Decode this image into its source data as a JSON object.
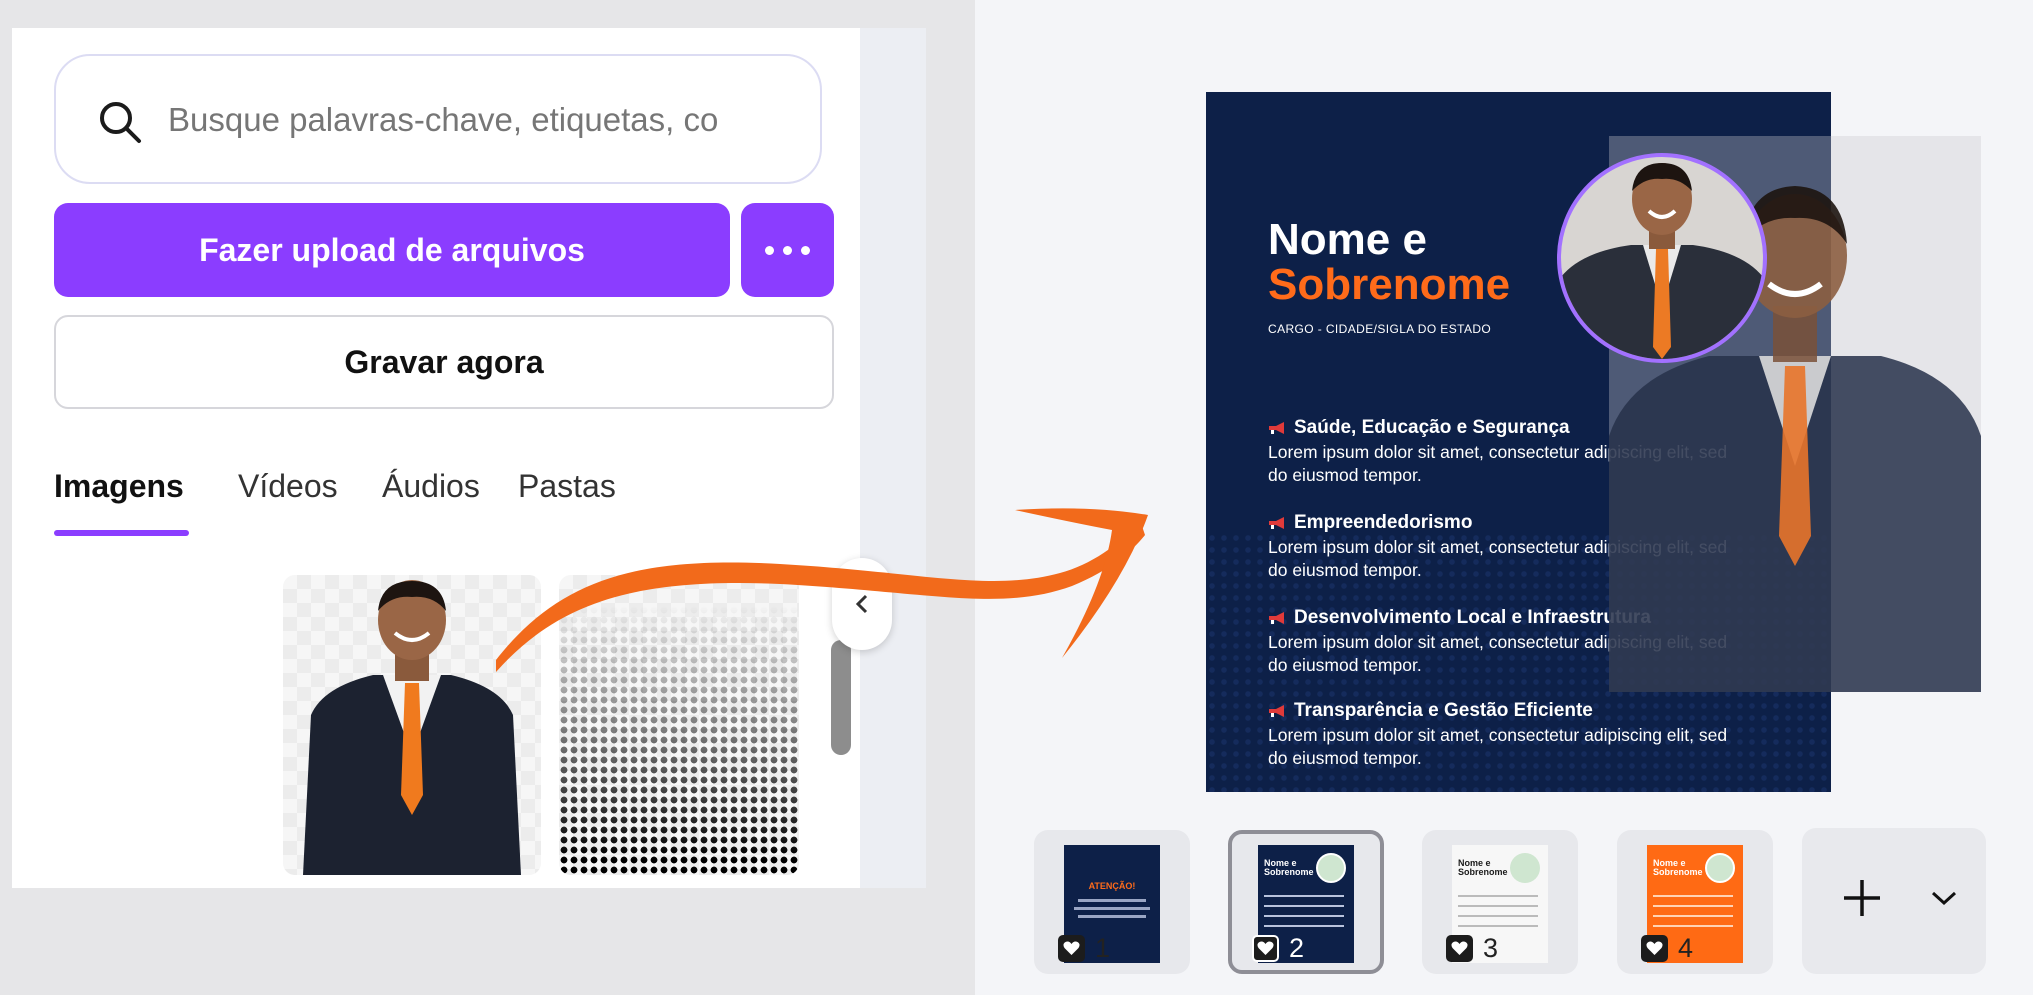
{
  "search": {
    "placeholder": "Busque palavras-chave, etiquetas, co"
  },
  "buttons": {
    "upload_label": "Fazer upload de arquivos",
    "more_icon": "more-horizontal-icon",
    "record_label": "Gravar agora"
  },
  "tabs": [
    {
      "label": "Imagens",
      "active": true
    },
    {
      "label": "Vídeos",
      "active": false
    },
    {
      "label": "Áudios",
      "active": false
    },
    {
      "label": "Pastas",
      "active": false
    }
  ],
  "flyer": {
    "name_line1": "Nome e",
    "name_line2": "Sobrenome",
    "role": "CARGO - CIDADE/SIGLA DO ESTADO",
    "items": [
      {
        "title": "Saúde, Educação e Segurança",
        "body": "Lorem ipsum dolor sit amet, consectetur adipiscing elit, sed do eiusmod tempor."
      },
      {
        "title": "Empreendedorismo",
        "body": "Lorem ipsum dolor sit amet, consectetur adipiscing elit, sed do eiusmod tempor."
      },
      {
        "title": "Desenvolvimento Local e Infraestrutura",
        "body": "Lorem ipsum dolor sit amet, consectetur adipiscing elit, sed do eiusmod tempor."
      },
      {
        "title": "Transparência e Gestão Eficiente",
        "body": "Lorem ipsum dolor sit amet, consectetur adipiscing elit, sed do eiusmod tempor."
      }
    ]
  },
  "page_thumbs": [
    {
      "number": "1",
      "mini_title": "ATENÇÃO!"
    },
    {
      "number": "2",
      "mini_title": "Nome e Sobrenome"
    },
    {
      "number": "3",
      "mini_title": "Nome e Sobrenome"
    },
    {
      "number": "4",
      "mini_title": "Nome e Sobrenome"
    }
  ],
  "colors": {
    "accent": "#8b3dff",
    "flyer_bg": "#0d2048",
    "flyer_orange": "#ff6b1a",
    "arrow": "#f26a1b"
  }
}
